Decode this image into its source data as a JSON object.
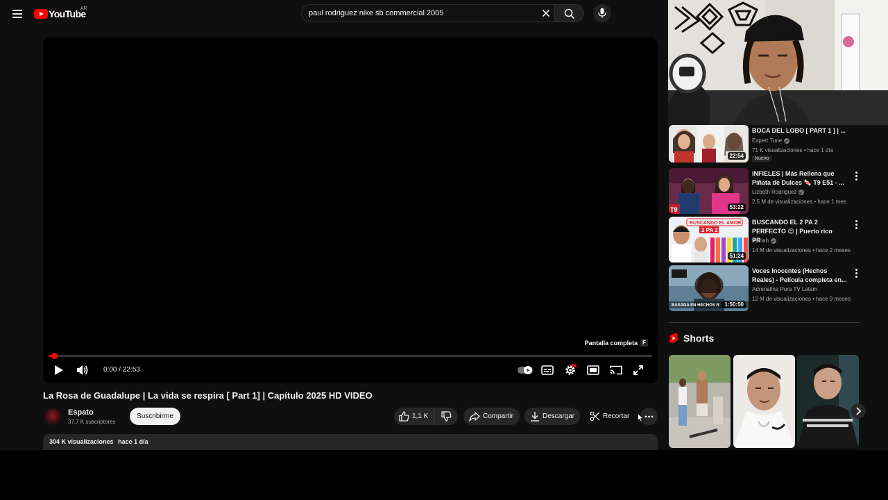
{
  "masthead": {
    "logo_text": "YouTube",
    "country_code": "AR",
    "search_value": "paul rodriguez nike sb commercial 2005"
  },
  "player": {
    "fullscreen_tooltip": "Pantalla completa",
    "fullscreen_key": "F",
    "time_display": "0:00 / 22:53",
    "progress_fraction": 0.015,
    "progress_color": "#ff0000"
  },
  "video": {
    "title": "La Rosa de Guadalupe | La vida se respira [ Part 1] | Capítulo 2025 HD VIDEO",
    "channel_name": "Espato",
    "channel_subs": "37,7 K suscriptores",
    "subscribe_label": "Suscribirme",
    "like_count": "1,1 K",
    "share_label": "Compartir",
    "download_label": "Descargar",
    "clip_label": "Recortar",
    "views": "304 K visualizaciones",
    "age": "hace 1 día"
  },
  "recommendations": [
    {
      "title": "BOCA DEL LOBO [ PART 1 ] | ...",
      "channel": "Expert Tune",
      "views": "71 K visualizaciones",
      "age": "hace 1 día",
      "duration": "22:54",
      "badge": "Nuevo"
    },
    {
      "title": "INFIELES | Más Rellena que Piñata de Dulces 🍬 T9 E51 - ...",
      "channel": "Lizbeth Rodriguez",
      "views": "2,5 M de visualizaciones",
      "age": "hace 1 mes",
      "duration": "53:22",
      "thumb_tag": "T9"
    },
    {
      "title": "BUSCANDO EL 2 PA 2 PERFECTO 😍 | Puerto rico PR",
      "channel": "lebriah",
      "views": "14 M de visualizaciones",
      "age": "hace 2 meses",
      "duration": "51:24",
      "thumb_text_top": "BUSCANDO EL AMOR",
      "thumb_text_sub": "2 PA 2"
    },
    {
      "title": "Voces Inocentes (Hechos Reales) - Película completa en...",
      "channel": "Adrenalina Pura TV Latam",
      "views": "12 M de visualizaciones",
      "age": "hace 9 meses",
      "duration": "1:50:50",
      "thumb_caption": "BASADA EN HECHOS R"
    }
  ],
  "shorts": {
    "heading": "Shorts",
    "brand_color": "#ff0000"
  },
  "icons": [
    "menu-icon",
    "search-icon",
    "clear-icon",
    "mic-icon",
    "play-icon",
    "volume-icon",
    "autoplay-toggle-icon",
    "subtitles-icon",
    "settings-icon",
    "theater-icon",
    "cast-icon",
    "fullscreen-icon",
    "like-icon",
    "dislike-icon",
    "share-icon",
    "download-icon",
    "clip-icon",
    "more-icon",
    "chevron-right-icon"
  ]
}
